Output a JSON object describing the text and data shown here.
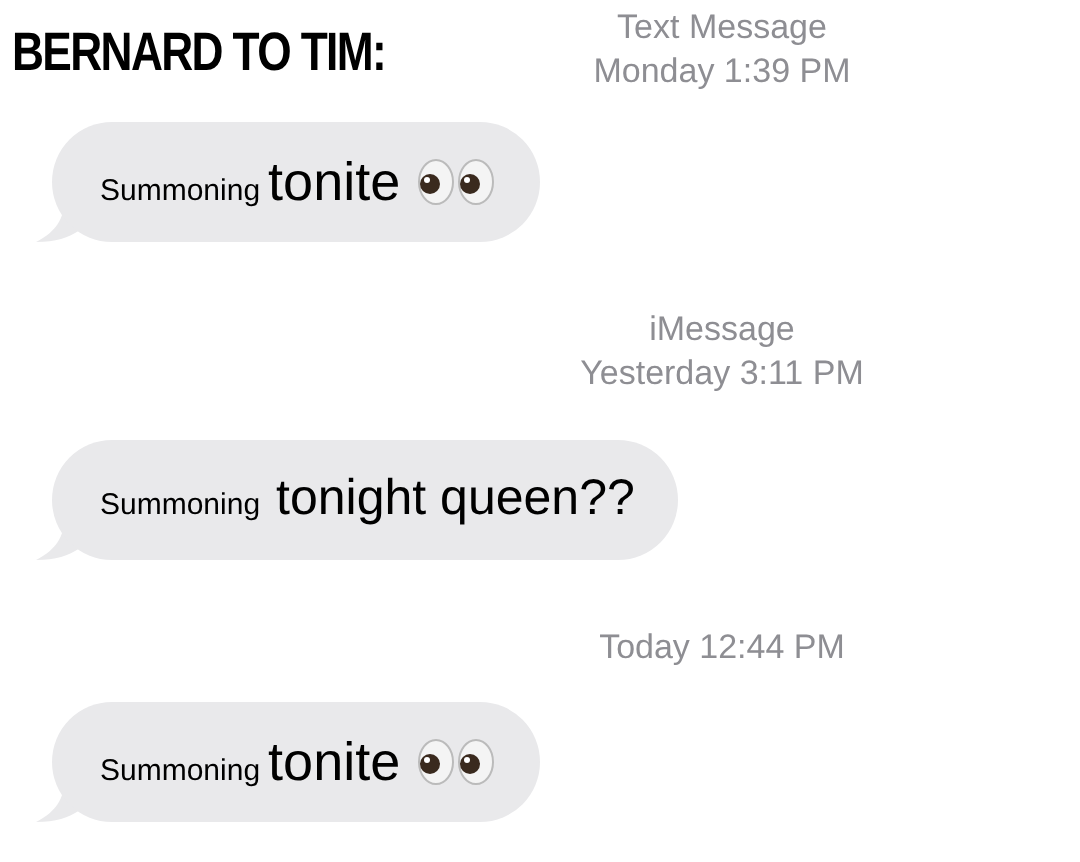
{
  "caption": "BERNARD TO TIM:",
  "threads": [
    {
      "header": [
        "Text Message",
        "Monday 1:39 PM"
      ],
      "bubble": {
        "small": "Summoning",
        "large": "tonite",
        "emoji": true
      }
    },
    {
      "header": [
        "iMessage",
        "Yesterday 3:11 PM"
      ],
      "bubble": {
        "small": "Summoning",
        "large": "tonight queen??",
        "emoji": false
      }
    },
    {
      "header": [
        "Today 12:44 PM"
      ],
      "bubble": {
        "small": "Summoning",
        "large": "tonite",
        "emoji": true
      }
    }
  ]
}
